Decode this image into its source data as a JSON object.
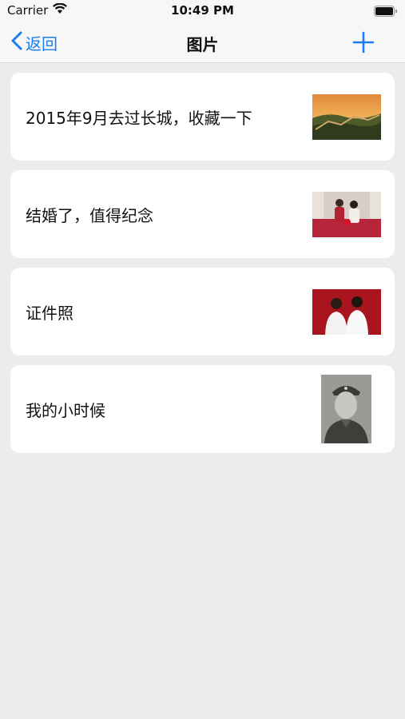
{
  "status": {
    "carrier": "Carrier",
    "time": "10:49 PM"
  },
  "nav": {
    "back_label": "返回",
    "title": "图片"
  },
  "items": [
    {
      "title": "2015年9月去过长城，收藏一下",
      "thumb": "great-wall-photo"
    },
    {
      "title": "结婚了，值得纪念",
      "thumb": "wedding-photo"
    },
    {
      "title": "证件照",
      "thumb": "couple-id-photo"
    },
    {
      "title": "我的小时候",
      "thumb": "vintage-portrait-photo"
    }
  ],
  "colors": {
    "accent": "#1a7cf5",
    "background": "#ececec",
    "card": "#ffffff"
  }
}
